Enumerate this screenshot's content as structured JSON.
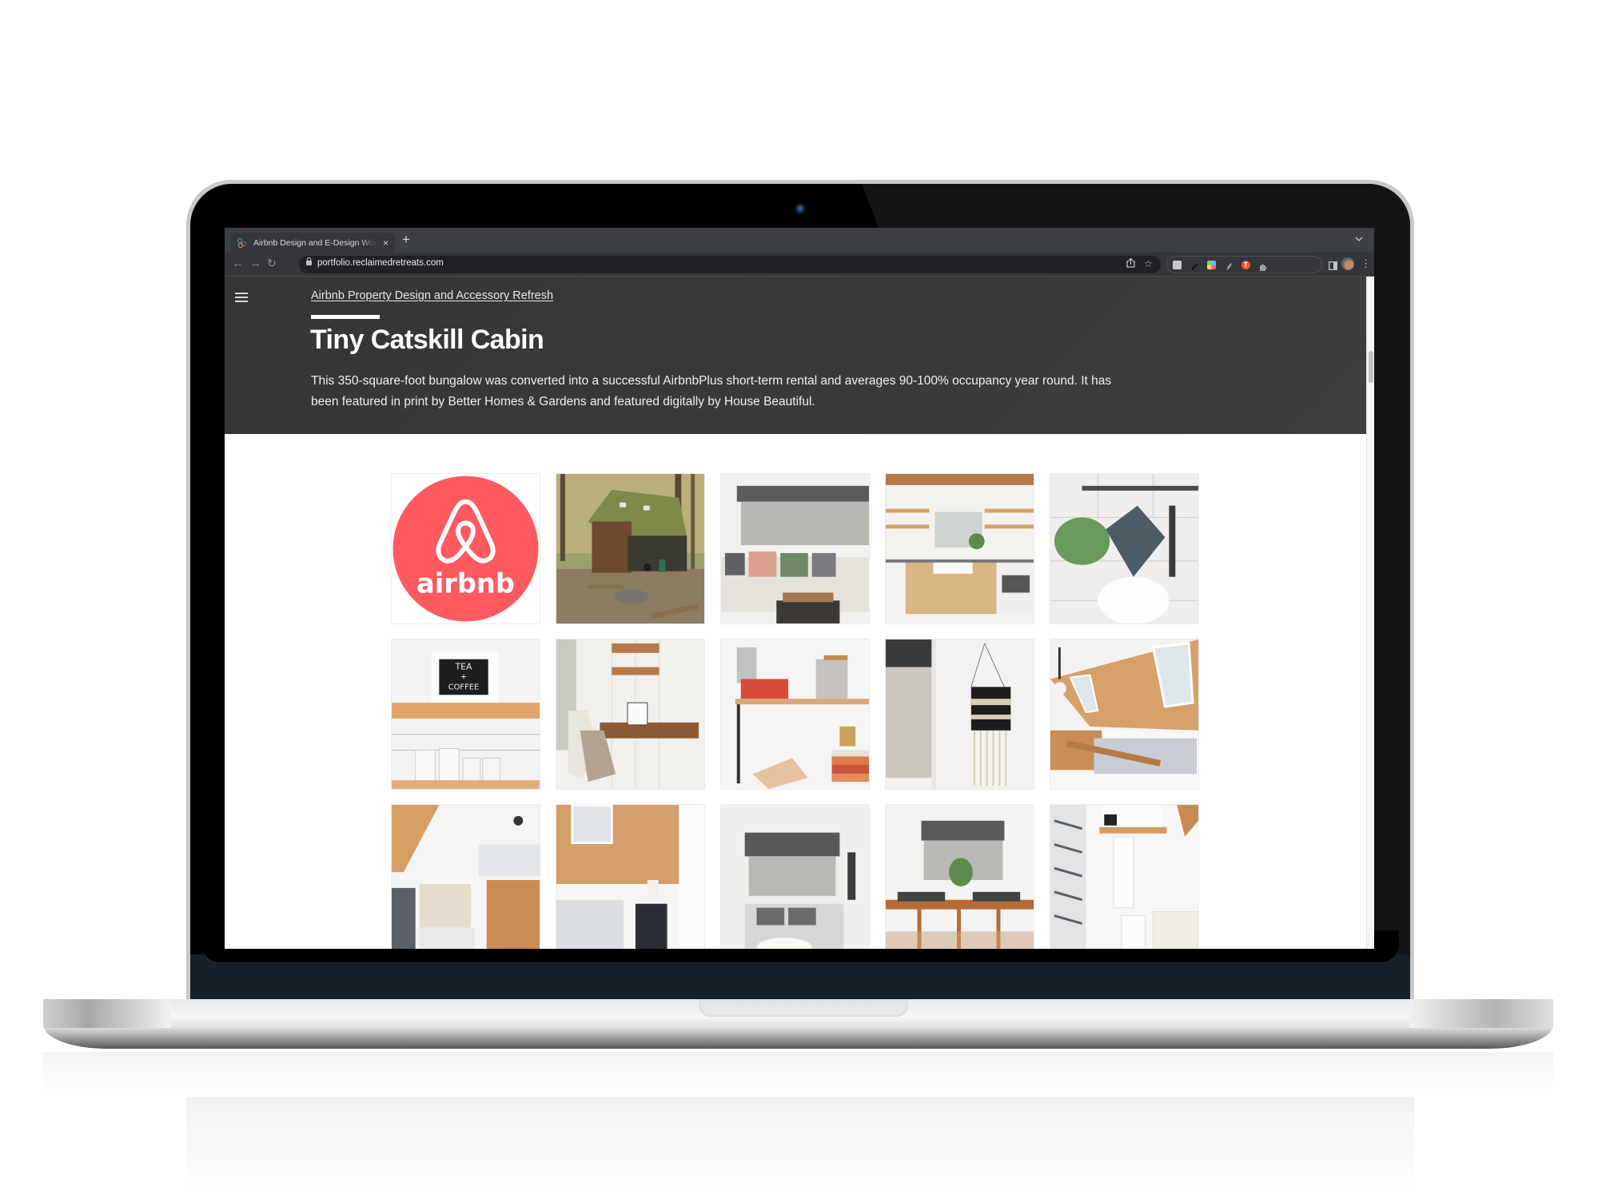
{
  "browser": {
    "tab": {
      "title": "Airbnb Design and E-Design Work",
      "close_icon": "×"
    },
    "new_tab_icon": "+",
    "tabstrip_menu_icon": "⌄",
    "nav": {
      "back_icon": "←",
      "forward_icon": "→",
      "reload_icon": "↻"
    },
    "address": {
      "url": "portfolio.reclaimedretreats.com"
    },
    "share_icon": "⇪",
    "bookmark_icon": "☆",
    "menu_icon": "⋮"
  },
  "page": {
    "breadcrumb": "Airbnb Property Design and Accessory Refresh",
    "title": "Tiny Catskill Cabin",
    "description": "This 350-square-foot bungalow was converted into a successful AirbnbPlus short-term rental and averages 90-100% occupancy year round. It has been featured in print by Better Homes & Gardens and featured digitally by House Beautiful.",
    "brand_color": "#ff5a5f",
    "gallery": [
      {
        "alt": "Airbnb logo",
        "logo_text": "airbnb"
      },
      {
        "alt": "Cabin exterior in the woods with fire pit"
      },
      {
        "alt": "Living room sofa with pillows under window"
      },
      {
        "alt": "Kitchen with open shelving and subway tile"
      },
      {
        "alt": "Kitchen utensil rail with greenery"
      },
      {
        "alt": "Tea and coffee canisters on shelf",
        "sign_text": [
          "TEA",
          "+",
          "COFFEE"
        ]
      },
      {
        "alt": "Writing desk nook with chair"
      },
      {
        "alt": "Vintage decor on wall shelves"
      },
      {
        "alt": "Woven wall hanging by window"
      },
      {
        "alt": "Loft bedroom with skylights"
      },
      {
        "alt": "Loft with storage bins and railing"
      },
      {
        "alt": "Bedroom under wood-paneled slope"
      },
      {
        "alt": "Daybed under window with roman shade"
      },
      {
        "alt": "Dining table with place settings"
      },
      {
        "alt": "Bathroom with towel shelf and sink"
      }
    ]
  }
}
